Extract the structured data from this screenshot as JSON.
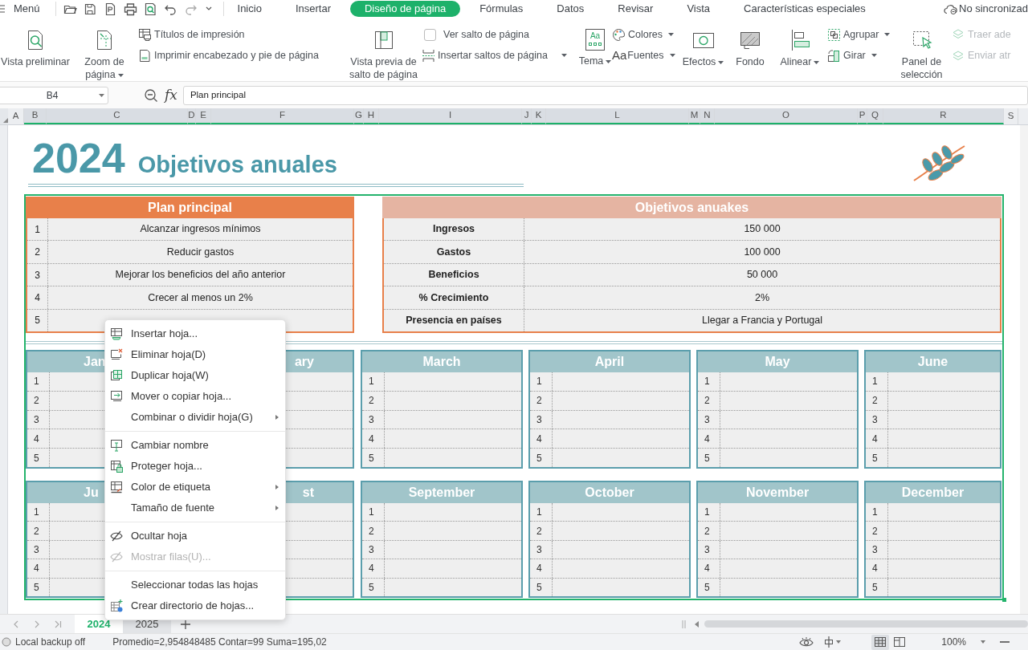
{
  "menu_bar": {
    "menu_label": "Menú",
    "tabs": [
      {
        "label": "Inicio",
        "selected": false
      },
      {
        "label": "Insertar",
        "selected": false
      },
      {
        "label": "Diseño de página",
        "selected": true
      },
      {
        "label": "Fórmulas",
        "selected": false
      },
      {
        "label": "Datos",
        "selected": false
      },
      {
        "label": "Revisar",
        "selected": false
      },
      {
        "label": "Vista",
        "selected": false
      },
      {
        "label": "Características especiales",
        "selected": false
      }
    ],
    "sync_status": "No sincronizad"
  },
  "ribbon": [
    {
      "kind": "big",
      "label": "Vista preliminar",
      "dropdown": false
    },
    {
      "kind": "big",
      "label": "Zoom de página",
      "dropdown": true
    },
    {
      "kind": "stack",
      "items": [
        {
          "kind": "button",
          "label": "Títulos de impresión",
          "dropdown": false,
          "disabled": false
        },
        {
          "kind": "button",
          "label": "Imprimir encabezado y pie de página",
          "dropdown": false,
          "disabled": false
        }
      ]
    },
    {
      "kind": "big",
      "label": "Vista previa de salto de página",
      "dropdown": false
    },
    {
      "kind": "stack",
      "items": [
        {
          "kind": "check",
          "label": "Ver salto de página",
          "checked": false
        },
        {
          "kind": "button",
          "label": "Insertar saltos de página",
          "dropdown": true,
          "disabled": false
        }
      ]
    },
    {
      "kind": "big",
      "label": "Tema",
      "icon_text": "Aa",
      "dropdown": true
    },
    {
      "kind": "stack",
      "items": [
        {
          "kind": "button",
          "label": "Colores",
          "dropdown": true,
          "disabled": false
        },
        {
          "kind": "button",
          "label": "Fuentes",
          "icon_text": "Aa",
          "dropdown": true,
          "disabled": false
        }
      ]
    },
    {
      "kind": "big",
      "label": "Efectos",
      "dropdown": true
    },
    {
      "kind": "big",
      "label": "Fondo",
      "dropdown": false
    },
    {
      "kind": "big",
      "label": "Alinear",
      "dropdown": true
    },
    {
      "kind": "stack",
      "items": [
        {
          "kind": "button",
          "label": "Agrupar",
          "dropdown": true,
          "disabled": false
        },
        {
          "kind": "button",
          "label": "Girar",
          "dropdown": true,
          "disabled": false
        }
      ]
    },
    {
      "kind": "big",
      "label": "Panel de selección"
    },
    {
      "kind": "stack",
      "items": [
        {
          "kind": "button",
          "label": "Traer ade",
          "disabled": true
        },
        {
          "kind": "button",
          "label": "Enviar atr",
          "disabled": true
        }
      ]
    }
  ],
  "formula_bar": {
    "cell_ref": "B4",
    "fx": "fx",
    "value": "Plan principal"
  },
  "column_headers": [
    {
      "label": "A",
      "selected": false
    },
    {
      "label": "B",
      "selected": true
    },
    {
      "label": "C",
      "selected": true
    },
    {
      "label": "D",
      "selected": true
    },
    {
      "label": "E",
      "selected": true
    },
    {
      "label": "F",
      "selected": true
    },
    {
      "label": "G",
      "selected": true
    },
    {
      "label": "H",
      "selected": true
    },
    {
      "label": "I",
      "selected": true
    },
    {
      "label": "J",
      "selected": true
    },
    {
      "label": "K",
      "selected": true
    },
    {
      "label": "L",
      "selected": true
    },
    {
      "label": "M",
      "selected": true
    },
    {
      "label": "N",
      "selected": true
    },
    {
      "label": "O",
      "selected": true
    },
    {
      "label": "P",
      "selected": true
    },
    {
      "label": "Q",
      "selected": true
    },
    {
      "label": "R",
      "selected": true
    },
    {
      "label": "S",
      "selected": false
    }
  ],
  "sheet": {
    "year": "2024",
    "title": "Objetivos anuales",
    "plan": {
      "title": "Plan principal",
      "rows": [
        {
          "n": "1",
          "text": "Alcanzar ingresos mínimos"
        },
        {
          "n": "2",
          "text": "Reducir gastos"
        },
        {
          "n": "3",
          "text": "Mejorar los beneficios del año anterior"
        },
        {
          "n": "4",
          "text": "Crecer al menos un 2%"
        },
        {
          "n": "5"
        }
      ]
    },
    "objectives": {
      "title": "Objetivos anuakes",
      "rows": [
        {
          "label": "Ingresos",
          "value": "150 000"
        },
        {
          "label": "Gastos",
          "value": "100 000"
        },
        {
          "label": "Beneficios",
          "value": "50 000"
        },
        {
          "label": "% Crecimiento",
          "value": "2%"
        },
        {
          "label": "Presencia en países",
          "value": "Llegar a Francia y Portugal"
        }
      ]
    },
    "months": [
      {
        "name": "Jan",
        "rows": [
          "1",
          "2",
          "3",
          "4",
          "5"
        ]
      },
      {
        "name": "ary"
      },
      {
        "name": "March",
        "rows": [
          "1",
          "2",
          "3",
          "4",
          "5"
        ]
      },
      {
        "name": "April",
        "rows": [
          "1",
          "2",
          "3",
          "4",
          "5"
        ]
      },
      {
        "name": "May",
        "rows": [
          "1",
          "2",
          "3",
          "4",
          "5"
        ]
      },
      {
        "name": "June",
        "rows": [
          "1",
          "2",
          "3",
          "4",
          "5"
        ]
      },
      {
        "name": "Ju",
        "rows": [
          "1",
          "2",
          "3",
          "4",
          "5"
        ]
      },
      {
        "name": "st"
      },
      {
        "name": "September",
        "rows": [
          "1",
          "2",
          "3",
          "4",
          "5"
        ]
      },
      {
        "name": "October",
        "rows": [
          "1",
          "2",
          "3",
          "4",
          "5"
        ]
      },
      {
        "name": "November",
        "rows": [
          "1",
          "2",
          "3",
          "4",
          "5"
        ]
      },
      {
        "name": "December",
        "rows": [
          "1",
          "2",
          "3",
          "4",
          "5"
        ]
      }
    ]
  },
  "context_menu": {
    "groups": [
      [
        {
          "label": "Insertar hoja...",
          "submenu": false,
          "disabled": false
        },
        {
          "label": "Eliminar hoja(D)",
          "submenu": false,
          "disabled": false
        },
        {
          "label": "Duplicar hoja(W)",
          "submenu": false,
          "disabled": false
        },
        {
          "label": "Mover o copiar hoja...",
          "submenu": false,
          "disabled": false
        },
        {
          "label": "Combinar o dividir hoja(G)",
          "submenu": true,
          "disabled": false
        }
      ],
      [
        {
          "label": "Cambiar nombre",
          "submenu": false,
          "disabled": false
        },
        {
          "label": "Proteger hoja...",
          "submenu": false,
          "disabled": false
        },
        {
          "label": "Color de etiqueta",
          "submenu": true,
          "disabled": false
        },
        {
          "label": "Tamaño de fuente",
          "submenu": true,
          "disabled": false
        }
      ],
      [
        {
          "label": "Ocultar hoja",
          "submenu": false,
          "disabled": false
        },
        {
          "label": "Mostrar filas(U)...",
          "submenu": false,
          "disabled": true
        }
      ],
      [
        {
          "label": "Seleccionar todas las hojas",
          "submenu": false,
          "disabled": false
        },
        {
          "label": "Crear directorio de hojas...",
          "submenu": false,
          "disabled": false
        }
      ]
    ]
  },
  "sheet_tabs": [
    {
      "label": "2024",
      "selected": true
    },
    {
      "label": "2025",
      "selected": false
    }
  ],
  "status_bar": {
    "backup": "Local backup off",
    "stats": "Promedio=2,954848485 Contar=99 Suma=195,02",
    "zoom": "100%"
  }
}
